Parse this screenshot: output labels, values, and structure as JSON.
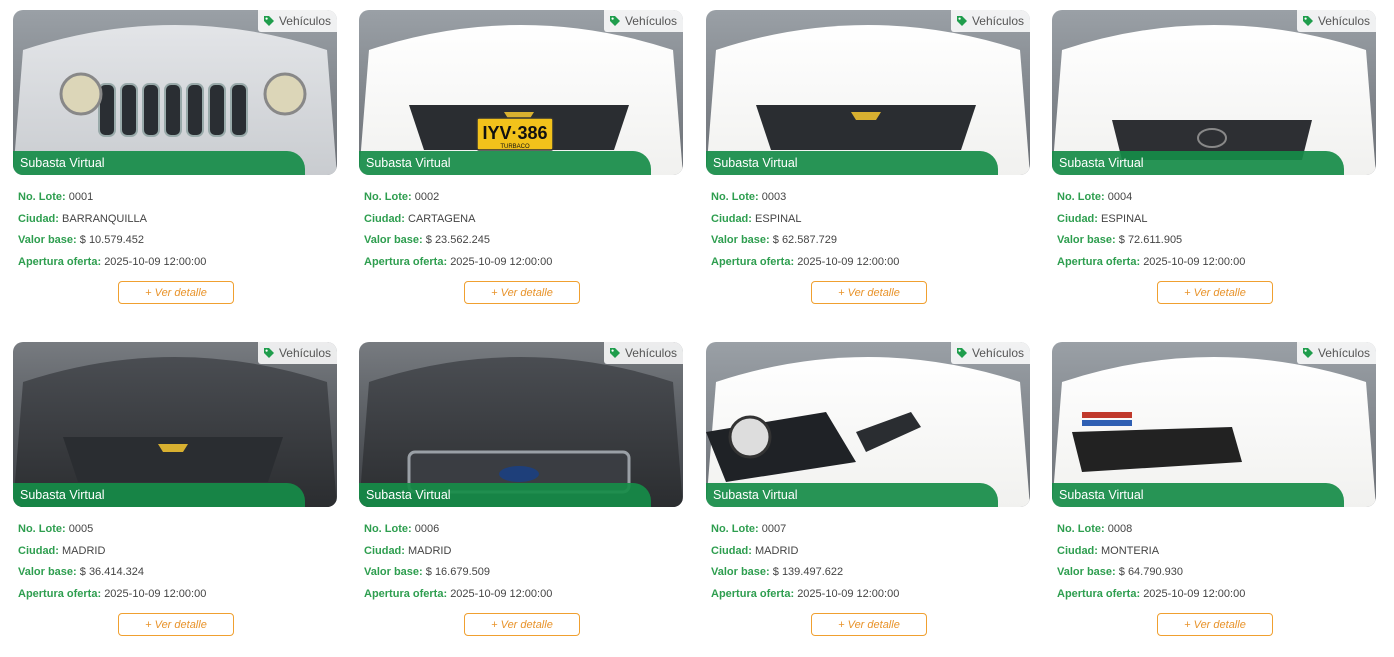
{
  "colors": {
    "accent_green": "#2e9e4f",
    "banner_green": "#168c48",
    "button_orange": "#f0a030"
  },
  "labels": {
    "category": "Vehículos",
    "auction_type": "Subasta Virtual",
    "lot": "No. Lote:",
    "city": "Ciudad:",
    "base_value": "Valor base:",
    "opening": "Apertura oferta:",
    "detail_button": "+ Ver detalle"
  },
  "icons": {
    "category_tag": "tag-icon"
  },
  "lots": [
    {
      "lot": "0001",
      "city": "BARRANQUILLA",
      "base_value": "$ 10.579.452",
      "opening": "2025-10-09 12:00:00",
      "car_color": "silver",
      "brand": "jeep"
    },
    {
      "lot": "0002",
      "city": "CARTAGENA",
      "base_value": "$ 23.562.245",
      "opening": "2025-10-09 12:00:00",
      "car_color": "white",
      "brand": "chevrolet",
      "plate": "IYV·386",
      "plate_city": "TURBACO"
    },
    {
      "lot": "0003",
      "city": "ESPINAL",
      "base_value": "$ 62.587.729",
      "opening": "2025-10-09 12:00:00",
      "car_color": "white",
      "brand": "chevrolet"
    },
    {
      "lot": "0004",
      "city": "ESPINAL",
      "base_value": "$ 72.611.905",
      "opening": "2025-10-09 12:00:00",
      "car_color": "white",
      "brand": "hyundai"
    },
    {
      "lot": "0005",
      "city": "MADRID",
      "base_value": "$ 36.414.324",
      "opening": "2025-10-09 12:00:00",
      "car_color": "black",
      "brand": "chevrolet"
    },
    {
      "lot": "0006",
      "city": "MADRID",
      "base_value": "$ 16.679.509",
      "opening": "2025-10-09 12:00:00",
      "car_color": "black",
      "brand": "ford"
    },
    {
      "lot": "0007",
      "city": "MADRID",
      "base_value": "$ 139.497.622",
      "opening": "2025-10-09 12:00:00",
      "car_color": "white",
      "brand": "mercedes"
    },
    {
      "lot": "0008",
      "city": "MONTERIA",
      "base_value": "$ 64.790.930",
      "opening": "2025-10-09 12:00:00",
      "car_color": "white",
      "brand": "ford-mustang"
    }
  ]
}
